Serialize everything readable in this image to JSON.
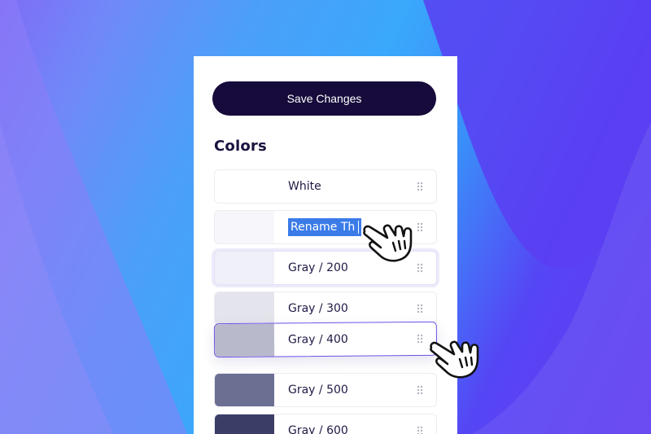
{
  "toolbar": {
    "save_label": "Save Changes"
  },
  "section": {
    "title": "Colors"
  },
  "colors": [
    {
      "name": "White",
      "hex": "#ffffff"
    },
    {
      "name": "Rename Th",
      "hex": "#f7f7fb",
      "state": "editing"
    },
    {
      "name": "Gray / 200",
      "hex": "#f0f0f8",
      "state": "hover"
    },
    {
      "name": "Gray / 300",
      "hex": "#e4e4ec"
    },
    {
      "name": "Gray / 400",
      "hex": "#b8bacb",
      "state": "dragging"
    },
    {
      "name": "Gray / 500",
      "hex": "#6b6f92"
    },
    {
      "name": "Gray / 600",
      "hex": "#3b3d66"
    }
  ],
  "icons": {
    "drag_handle": "drag-handle-icon",
    "cursor": "hand-pointer-icon"
  },
  "theme": {
    "button_bg": "#170b3b",
    "selection": "#3a7be8",
    "drag_border": "#6d54e8"
  }
}
